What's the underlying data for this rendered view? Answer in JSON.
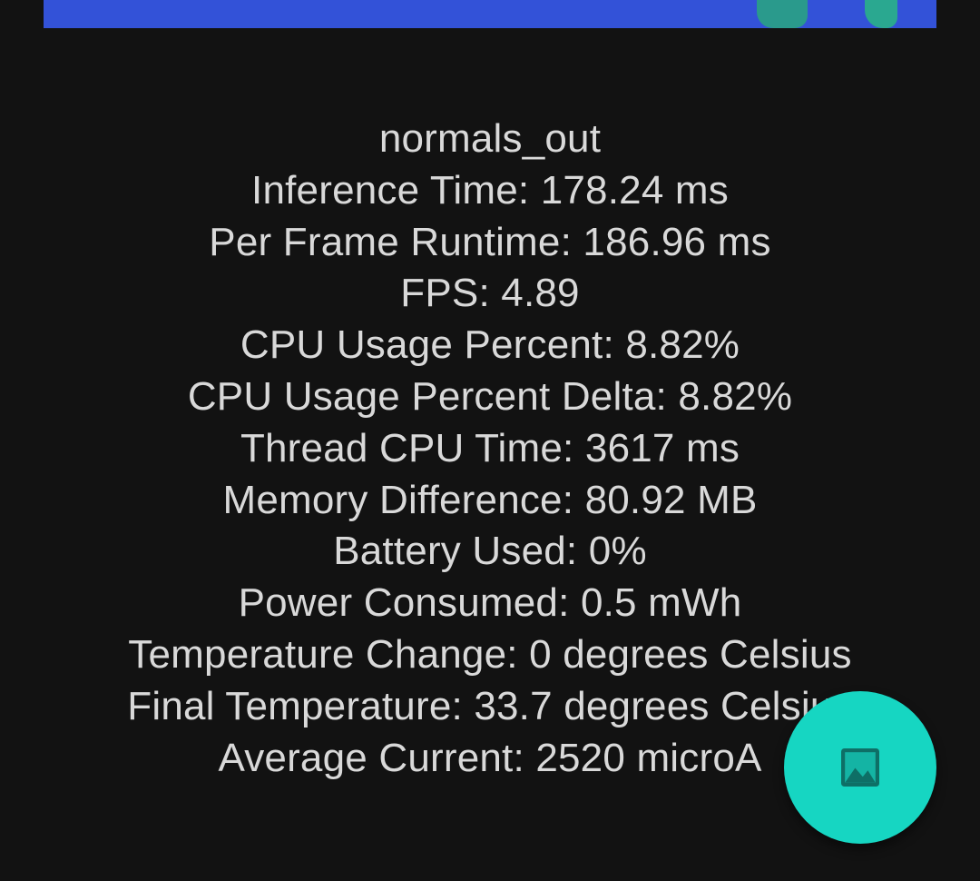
{
  "result": {
    "lines": [
      "normals_out",
      "Inference Time: 178.24 ms",
      "Per Frame Runtime: 186.96 ms",
      "FPS: 4.89",
      "CPU Usage Percent: 8.82%",
      "CPU Usage Percent Delta: 8.82%",
      "Thread CPU Time: 3617 ms",
      "Memory Difference: 80.92 MB",
      "Battery Used: 0%",
      "Power Consumed: 0.5 mWh",
      "Temperature Change: 0 degrees Celsius",
      "Final Temperature: 33.7 degrees Celsius",
      "Average Current: 2520 microA"
    ]
  },
  "fab": {
    "icon": "image-icon"
  },
  "colors": {
    "background": "#121212",
    "text": "#d9d9d9",
    "fab": "#16d6c2",
    "image_strip": "#3352d8"
  }
}
